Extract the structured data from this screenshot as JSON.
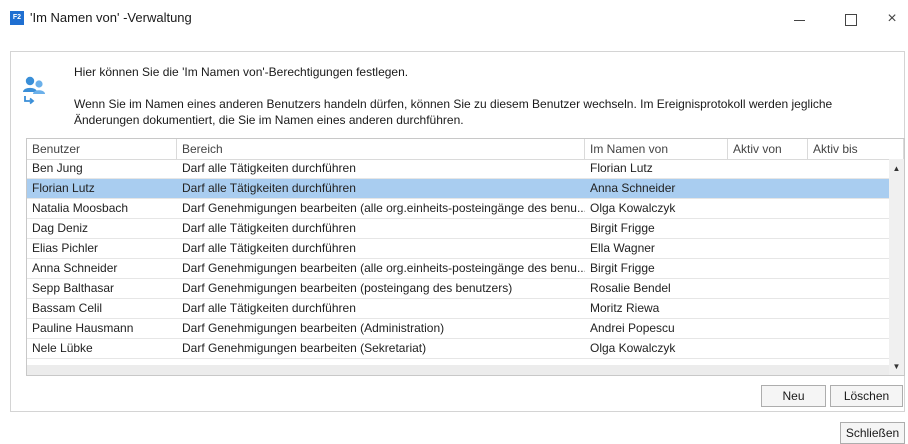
{
  "window": {
    "title": "'Im Namen von' -Verwaltung",
    "app_icon_text": "F2",
    "minimize_icon": "minimize-icon",
    "maximize_icon": "maximize-icon",
    "close_glyph": "×"
  },
  "info": {
    "line1": "Hier können Sie die 'Im Namen von'-Berechtigungen festlegen.",
    "line2": "Wenn Sie im Namen eines anderen Benutzers handeln dürfen, können Sie zu diesem Benutzer wechseln. Im Ereignisprotokoll werden jegliche Änderungen dokumentiert, die Sie im Namen eines anderen durchführen.",
    "icon": "users-switch-icon",
    "icon_color": "#3a8fd8"
  },
  "table": {
    "columns": [
      "Benutzer",
      "Bereich",
      "Im Namen von",
      "Aktiv von",
      "Aktiv bis"
    ],
    "rows": [
      [
        "Ben Jung",
        "Darf alle Tätigkeiten durchführen",
        "Florian Lutz",
        "",
        ""
      ],
      [
        "Florian Lutz",
        "Darf alle Tätigkeiten durchführen",
        "Anna Schneider",
        "",
        ""
      ],
      [
        "Natalia Moosbach",
        "Darf Genehmigungen bearbeiten (alle org.einheits-posteingänge des benu...",
        "Olga Kowalczyk",
        "",
        ""
      ],
      [
        "Dag Deniz",
        "Darf alle Tätigkeiten durchführen",
        "Birgit Frigge",
        "",
        ""
      ],
      [
        "Elias Pichler",
        "Darf alle Tätigkeiten durchführen",
        "Ella Wagner",
        "",
        ""
      ],
      [
        "Anna Schneider",
        "Darf Genehmigungen bearbeiten (alle org.einheits-posteingänge des benu...",
        "Birgit Frigge",
        "",
        ""
      ],
      [
        "Sepp Balthasar",
        "Darf Genehmigungen bearbeiten (posteingang des benutzers)",
        "Rosalie Bendel",
        "",
        ""
      ],
      [
        "Bassam Celil",
        "Darf alle Tätigkeiten durchführen",
        "Moritz Riewa",
        "",
        ""
      ],
      [
        "Pauline Hausmann",
        "Darf Genehmigungen bearbeiten (Administration)",
        "Andrei Popescu",
        "",
        ""
      ],
      [
        "Nele Lübke",
        "Darf Genehmigungen bearbeiten (Sekretariat)",
        "Olga Kowalczyk",
        "",
        ""
      ]
    ],
    "selected_row": 1,
    "selection_color": "#a9cdf0",
    "scroll_up_glyph": "▲",
    "scroll_down_glyph": "▼"
  },
  "buttons": {
    "neu": "Neu",
    "loeschen": "Löschen",
    "schliessen": "Schließen"
  }
}
